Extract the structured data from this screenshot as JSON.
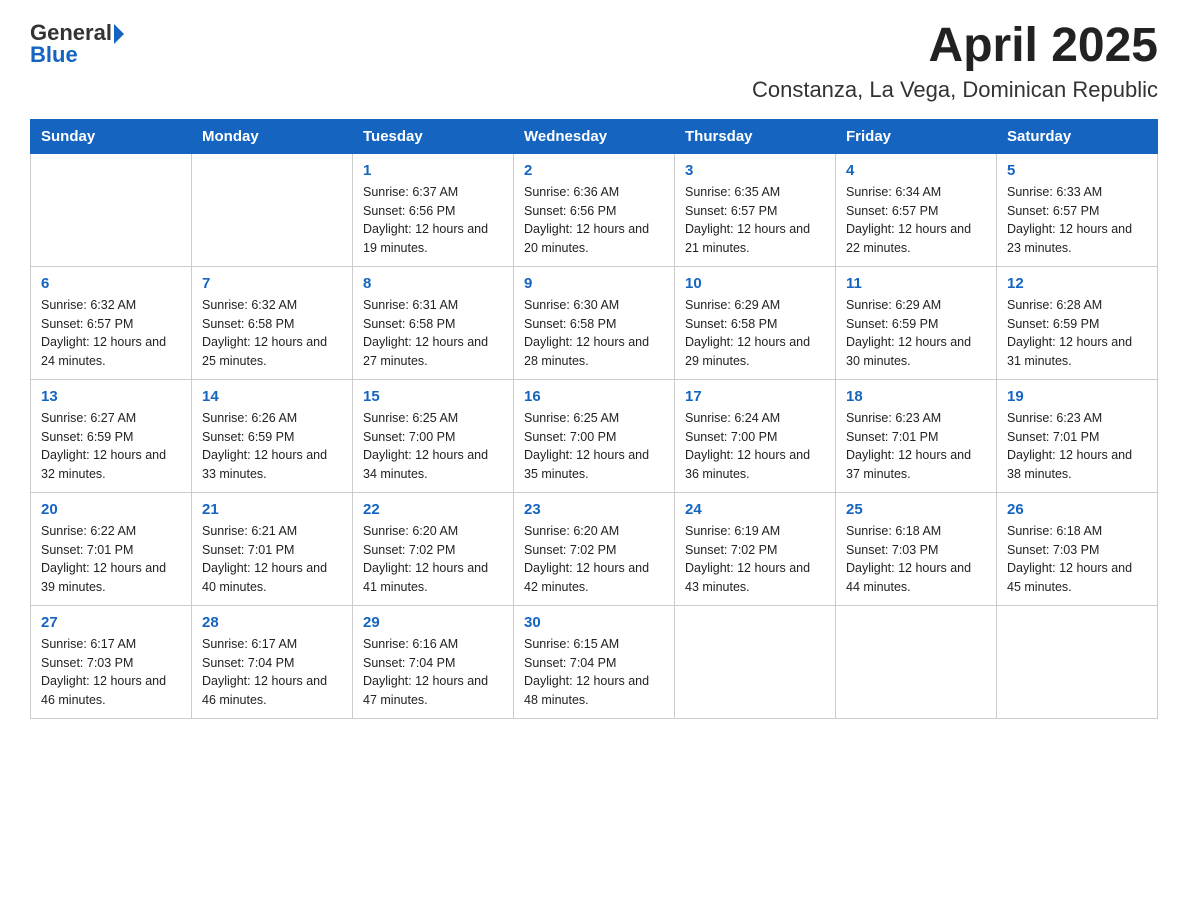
{
  "header": {
    "logo_general": "General",
    "logo_blue": "Blue",
    "month_year": "April 2025",
    "location": "Constanza, La Vega, Dominican Republic"
  },
  "weekdays": [
    "Sunday",
    "Monday",
    "Tuesday",
    "Wednesday",
    "Thursday",
    "Friday",
    "Saturday"
  ],
  "weeks": [
    [
      {
        "day": "",
        "sunrise": "",
        "sunset": "",
        "daylight": ""
      },
      {
        "day": "",
        "sunrise": "",
        "sunset": "",
        "daylight": ""
      },
      {
        "day": "1",
        "sunrise": "Sunrise: 6:37 AM",
        "sunset": "Sunset: 6:56 PM",
        "daylight": "Daylight: 12 hours and 19 minutes."
      },
      {
        "day": "2",
        "sunrise": "Sunrise: 6:36 AM",
        "sunset": "Sunset: 6:56 PM",
        "daylight": "Daylight: 12 hours and 20 minutes."
      },
      {
        "day": "3",
        "sunrise": "Sunrise: 6:35 AM",
        "sunset": "Sunset: 6:57 PM",
        "daylight": "Daylight: 12 hours and 21 minutes."
      },
      {
        "day": "4",
        "sunrise": "Sunrise: 6:34 AM",
        "sunset": "Sunset: 6:57 PM",
        "daylight": "Daylight: 12 hours and 22 minutes."
      },
      {
        "day": "5",
        "sunrise": "Sunrise: 6:33 AM",
        "sunset": "Sunset: 6:57 PM",
        "daylight": "Daylight: 12 hours and 23 minutes."
      }
    ],
    [
      {
        "day": "6",
        "sunrise": "Sunrise: 6:32 AM",
        "sunset": "Sunset: 6:57 PM",
        "daylight": "Daylight: 12 hours and 24 minutes."
      },
      {
        "day": "7",
        "sunrise": "Sunrise: 6:32 AM",
        "sunset": "Sunset: 6:58 PM",
        "daylight": "Daylight: 12 hours and 25 minutes."
      },
      {
        "day": "8",
        "sunrise": "Sunrise: 6:31 AM",
        "sunset": "Sunset: 6:58 PM",
        "daylight": "Daylight: 12 hours and 27 minutes."
      },
      {
        "day": "9",
        "sunrise": "Sunrise: 6:30 AM",
        "sunset": "Sunset: 6:58 PM",
        "daylight": "Daylight: 12 hours and 28 minutes."
      },
      {
        "day": "10",
        "sunrise": "Sunrise: 6:29 AM",
        "sunset": "Sunset: 6:58 PM",
        "daylight": "Daylight: 12 hours and 29 minutes."
      },
      {
        "day": "11",
        "sunrise": "Sunrise: 6:29 AM",
        "sunset": "Sunset: 6:59 PM",
        "daylight": "Daylight: 12 hours and 30 minutes."
      },
      {
        "day": "12",
        "sunrise": "Sunrise: 6:28 AM",
        "sunset": "Sunset: 6:59 PM",
        "daylight": "Daylight: 12 hours and 31 minutes."
      }
    ],
    [
      {
        "day": "13",
        "sunrise": "Sunrise: 6:27 AM",
        "sunset": "Sunset: 6:59 PM",
        "daylight": "Daylight: 12 hours and 32 minutes."
      },
      {
        "day": "14",
        "sunrise": "Sunrise: 6:26 AM",
        "sunset": "Sunset: 6:59 PM",
        "daylight": "Daylight: 12 hours and 33 minutes."
      },
      {
        "day": "15",
        "sunrise": "Sunrise: 6:25 AM",
        "sunset": "Sunset: 7:00 PM",
        "daylight": "Daylight: 12 hours and 34 minutes."
      },
      {
        "day": "16",
        "sunrise": "Sunrise: 6:25 AM",
        "sunset": "Sunset: 7:00 PM",
        "daylight": "Daylight: 12 hours and 35 minutes."
      },
      {
        "day": "17",
        "sunrise": "Sunrise: 6:24 AM",
        "sunset": "Sunset: 7:00 PM",
        "daylight": "Daylight: 12 hours and 36 minutes."
      },
      {
        "day": "18",
        "sunrise": "Sunrise: 6:23 AM",
        "sunset": "Sunset: 7:01 PM",
        "daylight": "Daylight: 12 hours and 37 minutes."
      },
      {
        "day": "19",
        "sunrise": "Sunrise: 6:23 AM",
        "sunset": "Sunset: 7:01 PM",
        "daylight": "Daylight: 12 hours and 38 minutes."
      }
    ],
    [
      {
        "day": "20",
        "sunrise": "Sunrise: 6:22 AM",
        "sunset": "Sunset: 7:01 PM",
        "daylight": "Daylight: 12 hours and 39 minutes."
      },
      {
        "day": "21",
        "sunrise": "Sunrise: 6:21 AM",
        "sunset": "Sunset: 7:01 PM",
        "daylight": "Daylight: 12 hours and 40 minutes."
      },
      {
        "day": "22",
        "sunrise": "Sunrise: 6:20 AM",
        "sunset": "Sunset: 7:02 PM",
        "daylight": "Daylight: 12 hours and 41 minutes."
      },
      {
        "day": "23",
        "sunrise": "Sunrise: 6:20 AM",
        "sunset": "Sunset: 7:02 PM",
        "daylight": "Daylight: 12 hours and 42 minutes."
      },
      {
        "day": "24",
        "sunrise": "Sunrise: 6:19 AM",
        "sunset": "Sunset: 7:02 PM",
        "daylight": "Daylight: 12 hours and 43 minutes."
      },
      {
        "day": "25",
        "sunrise": "Sunrise: 6:18 AM",
        "sunset": "Sunset: 7:03 PM",
        "daylight": "Daylight: 12 hours and 44 minutes."
      },
      {
        "day": "26",
        "sunrise": "Sunrise: 6:18 AM",
        "sunset": "Sunset: 7:03 PM",
        "daylight": "Daylight: 12 hours and 45 minutes."
      }
    ],
    [
      {
        "day": "27",
        "sunrise": "Sunrise: 6:17 AM",
        "sunset": "Sunset: 7:03 PM",
        "daylight": "Daylight: 12 hours and 46 minutes."
      },
      {
        "day": "28",
        "sunrise": "Sunrise: 6:17 AM",
        "sunset": "Sunset: 7:04 PM",
        "daylight": "Daylight: 12 hours and 46 minutes."
      },
      {
        "day": "29",
        "sunrise": "Sunrise: 6:16 AM",
        "sunset": "Sunset: 7:04 PM",
        "daylight": "Daylight: 12 hours and 47 minutes."
      },
      {
        "day": "30",
        "sunrise": "Sunrise: 6:15 AM",
        "sunset": "Sunset: 7:04 PM",
        "daylight": "Daylight: 12 hours and 48 minutes."
      },
      {
        "day": "",
        "sunrise": "",
        "sunset": "",
        "daylight": ""
      },
      {
        "day": "",
        "sunrise": "",
        "sunset": "",
        "daylight": ""
      },
      {
        "day": "",
        "sunrise": "",
        "sunset": "",
        "daylight": ""
      }
    ]
  ]
}
